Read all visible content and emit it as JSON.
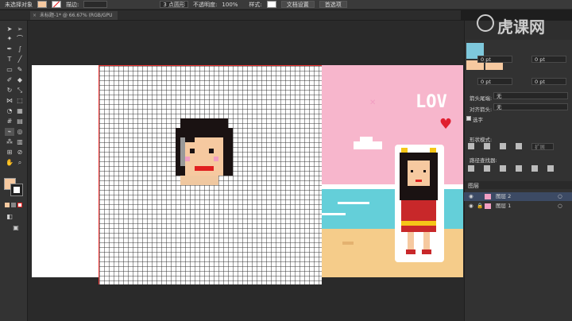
{
  "top_bar": {
    "selection_label": "未选择对象",
    "stroke_label": "描边:",
    "stroke_value": "",
    "brush_label": "3 点圆形",
    "opacity_label": "不透明度:",
    "opacity_value": "100%",
    "style_label": "样式:",
    "doc_settings": "文档设置",
    "preferences": "首选项"
  },
  "tab": {
    "title": "未标题-1* @ 66.67% (RGB/GPU 预览)"
  },
  "panel": {
    "unit1": "0 pt",
    "unit2": "0 pt",
    "unit3": "0 pt",
    "unit4": "0 pt",
    "arrowhead_label": "箭头尾端:",
    "arrowhead_value": "无",
    "align_label": "对齐箭头:",
    "align_value": "无",
    "select_label": "选字",
    "shape_mode": "形状模式:",
    "expand": "扩展",
    "pathfinder": "路径查找器:",
    "layers_tab": "图层",
    "layer2": "图层 2",
    "layer1": "图层 1"
  },
  "watermark": {
    "brand": "虎课网"
  },
  "colors": {
    "fill": "#f6c9a0",
    "accent": "#f19ec2",
    "sea": "#64cfd9",
    "sand": "#f5cc8a"
  }
}
